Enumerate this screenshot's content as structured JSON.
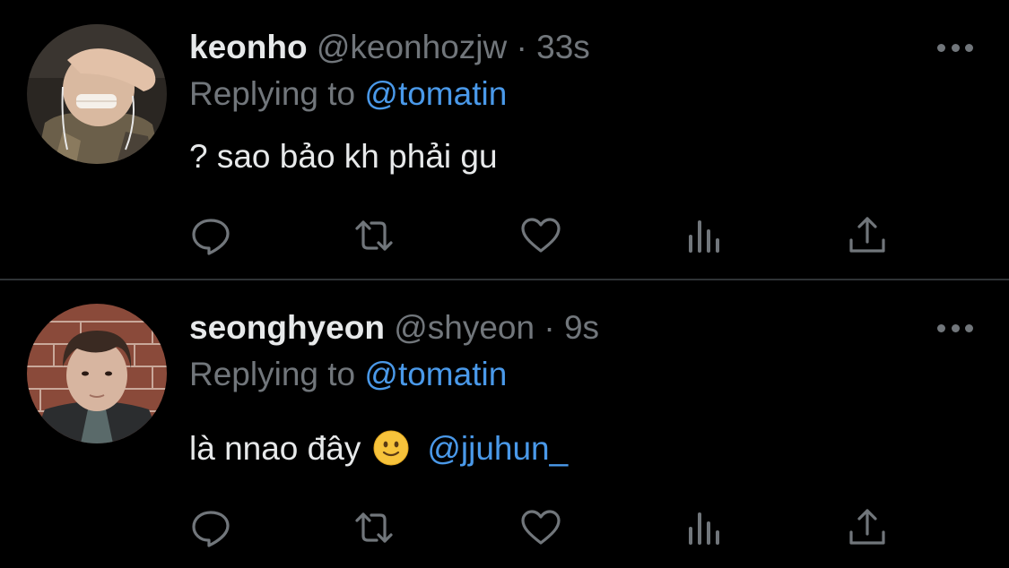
{
  "tweets": [
    {
      "display_name": "keonho",
      "handle": "@keonhozjw",
      "separator": " · ",
      "time": "33s",
      "replying_prefix": "Replying to ",
      "replying_to": "@tomatin",
      "text": "? sao bảo kh phải gu",
      "text_mention": "",
      "emoji": "",
      "avatar_icon": "profile-photo",
      "action_icons": [
        "reply-icon",
        "retweet-icon",
        "like-icon",
        "analytics-icon",
        "share-icon"
      ]
    },
    {
      "display_name": "seonghyeon",
      "handle": "@shyeon",
      "separator": " · ",
      "time": "9s",
      "replying_prefix": "Replying to ",
      "replying_to": "@tomatin",
      "text": "là nnao đây",
      "text_mention": "@jjuhun_",
      "emoji": "slightly-smiling-face",
      "avatar_icon": "profile-photo",
      "action_icons": [
        "reply-icon",
        "retweet-icon",
        "like-icon",
        "analytics-icon",
        "share-icon"
      ]
    }
  ],
  "colors": {
    "background": "#000000",
    "text_primary": "#e7e9ea",
    "text_secondary": "#71767b",
    "link": "#4a99e9",
    "divider": "#2f3336"
  }
}
